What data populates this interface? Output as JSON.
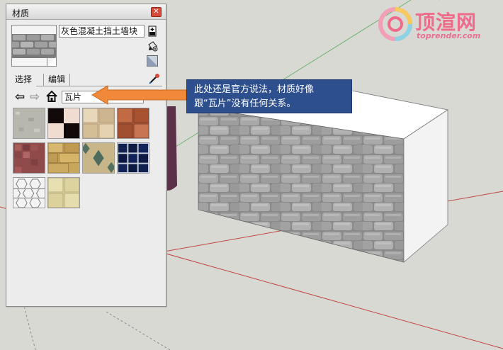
{
  "watermark": {
    "title": "顶渲网",
    "subtitle": "toprender.com"
  },
  "panel": {
    "title": "材质",
    "close_icon": "close-icon",
    "material_name": "灰色混凝土挡土墙块",
    "tabs": [
      "选择",
      "编辑"
    ],
    "collection": "瓦片",
    "swatches": [
      "light-gray-stone",
      "black-white-checker",
      "beige-marble-tiles",
      "terracotta-tiles",
      "red-mosaic",
      "yellow-stone-tiles",
      "diamond-inlay-tiles",
      "navy-blue-tiles",
      "white-hexagon-tiles",
      "pale-yellow-tiles"
    ]
  },
  "callout": {
    "text_line1": "此处还是官方说法，材质好像",
    "text_line2": "跟“瓦片”没有任何关系。",
    "arrow_color": "#f08a3a",
    "background_color": "#2e4f8d"
  }
}
